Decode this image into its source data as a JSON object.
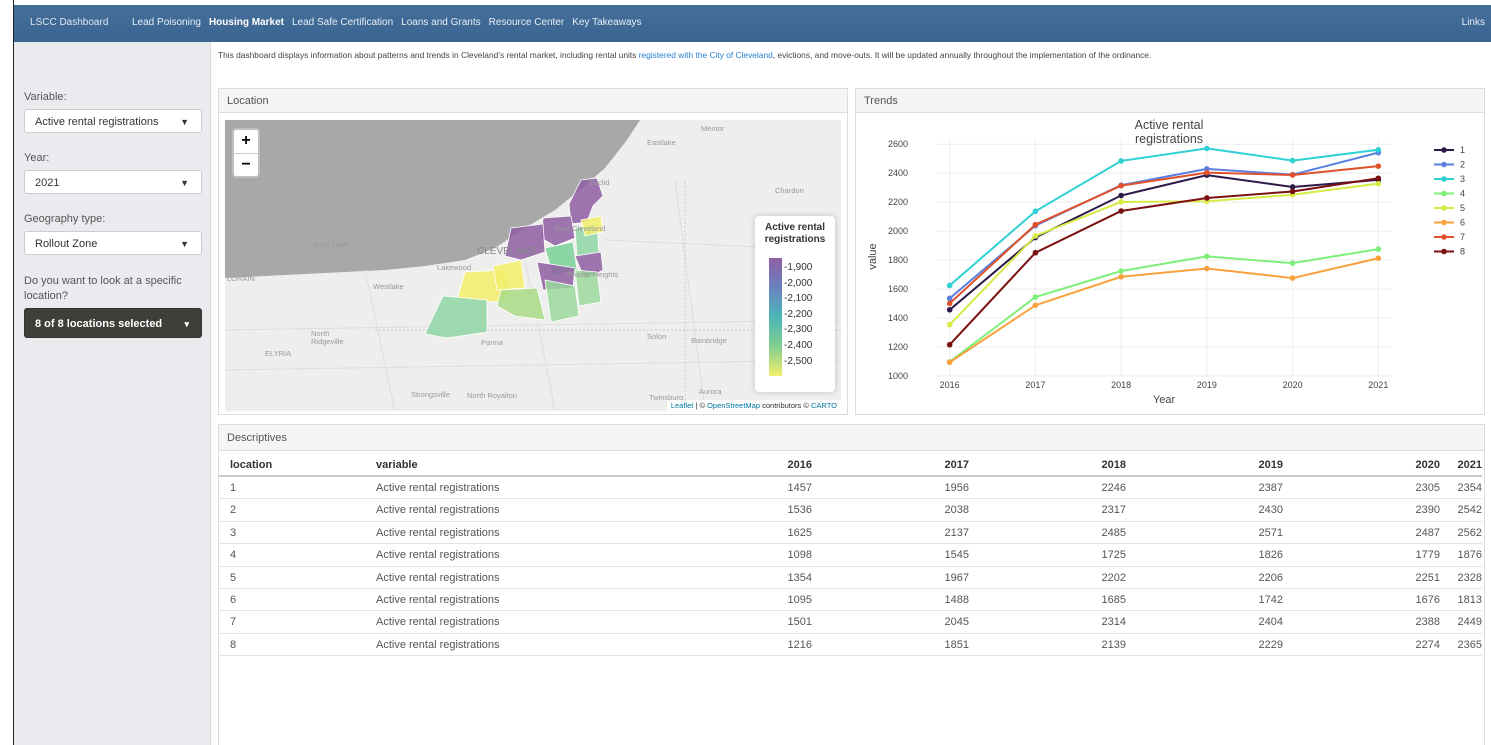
{
  "navbar": {
    "brand": "LSCC Dashboard",
    "items": [
      "Lead Poisoning",
      "Housing Market",
      "Lead Safe Certification",
      "Loans and Grants",
      "Resource Center",
      "Key Takeaways"
    ],
    "links": "Links"
  },
  "intro": {
    "before": "This dashboard displays information about patterns and trends in Cleveland’s rental market, including rental units ",
    "link": "registered with the City of Cleveland",
    "after": ", evictions, and move-outs. It will be updated annually throughout the implementation of the ordinance."
  },
  "sidebar": {
    "variable_label": "Variable:",
    "variable_value": "Active rental registrations",
    "year_label": "Year:",
    "year_value": "2021",
    "geo_label": "Geography type:",
    "geo_value": "Rollout Zone",
    "location_label": "Do you want to look at a specific location?",
    "location_value": "8 of 8 locations selected"
  },
  "location_panel": {
    "title": "Location",
    "zoom_in": "+",
    "zoom_out": "−",
    "legend_title": "Active rental registrations",
    "legend_ticks": [
      "1,900",
      "2,000",
      "2,100",
      "2,200",
      "2,300",
      "2,400",
      "2,500"
    ],
    "attribution": {
      "leaflet": "Leaflet",
      "osm": "OpenStreetMap",
      "mid": "contributors ©",
      "carto": "CARTO"
    },
    "place_labels": [
      "Mentor",
      "Eastlake",
      "Euclid",
      "Chardon",
      "East Cleveland",
      "Avon Lake",
      "CLEVELAND",
      "Lakewood",
      "Shaker Heights",
      "LORAIN",
      "Westlake",
      "North Ridgeville",
      "ELYRIA",
      "Parma",
      "Solon",
      "Bainbridge",
      "Strongsville",
      "North Royalton",
      "Twinsburg",
      "Aurora"
    ]
  },
  "trends_panel": {
    "title": "Trends"
  },
  "chart_data": {
    "type": "line",
    "title": "Active rental registrations",
    "xlabel": "Year",
    "ylabel": "value",
    "x": [
      2016,
      2017,
      2018,
      2019,
      2020,
      2021
    ],
    "ylim": [
      1000,
      2650
    ],
    "yticks": [
      1000,
      1200,
      1400,
      1600,
      1800,
      2000,
      2200,
      2400,
      2600
    ],
    "grid": true,
    "legend": "right",
    "series": [
      {
        "name": "1",
        "color": "#2d1a4a",
        "values": [
          1457,
          1956,
          2246,
          2387,
          2305,
          2354
        ]
      },
      {
        "name": "2",
        "color": "#5b7fdf",
        "values": [
          1536,
          2038,
          2317,
          2430,
          2390,
          2542
        ]
      },
      {
        "name": "3",
        "color": "#2fd0d4",
        "values": [
          1625,
          2137,
          2485,
          2571,
          2487,
          2562
        ]
      },
      {
        "name": "4",
        "color": "#7ef07a",
        "values": [
          1098,
          1545,
          1725,
          1826,
          1779,
          1876
        ]
      },
      {
        "name": "5",
        "color": "#d7ea45",
        "values": [
          1354,
          1967,
          2202,
          2206,
          2251,
          2328
        ]
      },
      {
        "name": "6",
        "color": "#f8a23e",
        "values": [
          1095,
          1488,
          1685,
          1742,
          1676,
          1813
        ]
      },
      {
        "name": "7",
        "color": "#e0512b",
        "values": [
          1501,
          2045,
          2314,
          2404,
          2388,
          2449
        ]
      },
      {
        "name": "8",
        "color": "#7a1010",
        "values": [
          1216,
          1851,
          2139,
          2229,
          2274,
          2365
        ]
      }
    ]
  },
  "descriptives": {
    "title": "Descriptives",
    "columns": [
      "location",
      "variable",
      "2016",
      "2017",
      "2018",
      "2019",
      "2020",
      "2021"
    ],
    "rows": [
      [
        "1",
        "Active rental registrations",
        "1457",
        "1956",
        "2246",
        "2387",
        "2305",
        "2354"
      ],
      [
        "2",
        "Active rental registrations",
        "1536",
        "2038",
        "2317",
        "2430",
        "2390",
        "2542"
      ],
      [
        "3",
        "Active rental registrations",
        "1625",
        "2137",
        "2485",
        "2571",
        "2487",
        "2562"
      ],
      [
        "4",
        "Active rental registrations",
        "1098",
        "1545",
        "1725",
        "1826",
        "1779",
        "1876"
      ],
      [
        "5",
        "Active rental registrations",
        "1354",
        "1967",
        "2202",
        "2206",
        "2251",
        "2328"
      ],
      [
        "6",
        "Active rental registrations",
        "1095",
        "1488",
        "1685",
        "1742",
        "1676",
        "1813"
      ],
      [
        "7",
        "Active rental registrations",
        "1501",
        "2045",
        "2314",
        "2404",
        "2388",
        "2449"
      ],
      [
        "8",
        "Active rental registrations",
        "1216",
        "1851",
        "2139",
        "2229",
        "2274",
        "2365"
      ]
    ]
  }
}
